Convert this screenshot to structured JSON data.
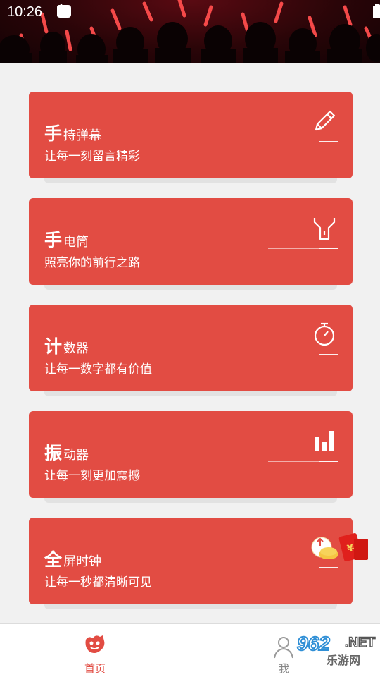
{
  "status_bar": {
    "time": "10:26",
    "icons_left": [
      "download-icon",
      "download-icon",
      "download-icon",
      "app-icon",
      "dot-icon"
    ],
    "icons_right": [
      "wifi-icon",
      "signal-icon",
      "battery-icon"
    ]
  },
  "cards": [
    {
      "big": "手",
      "rest": "持弹幕",
      "subtitle": "让每一刻留言精彩",
      "icon": "pencil-icon"
    },
    {
      "big": "手",
      "rest": "电筒",
      "subtitle": "照亮你的前行之路",
      "icon": "flashlight-icon"
    },
    {
      "big": "计",
      "rest": "数器",
      "subtitle": "让每一数字都有价值",
      "icon": "stopwatch-icon"
    },
    {
      "big": "振",
      "rest": "动器",
      "subtitle": "让每一刻更加震撼",
      "icon": "bar-chart-icon"
    },
    {
      "big": "全",
      "rest": "屏时钟",
      "subtitle": "让每一秒都清晰可见",
      "icon": "red-envelope-icon"
    }
  ],
  "bottom_nav": {
    "home_label": "首页",
    "me_label": "我"
  },
  "watermark": {
    "number": "962",
    "net": ".NET",
    "text": "乐游网"
  },
  "colors": {
    "card_red": "#e24c43",
    "background": "#f1f1f1",
    "nav_active": "#e24c43"
  }
}
